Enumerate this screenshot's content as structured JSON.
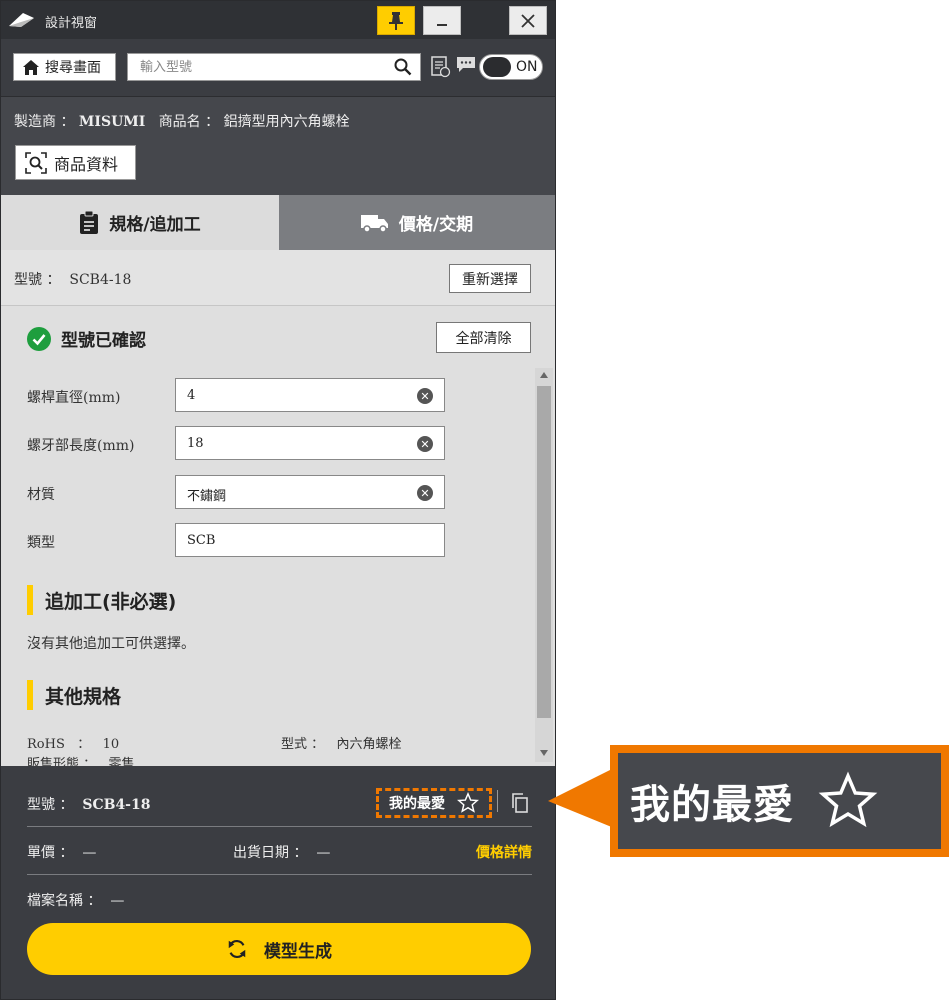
{
  "window": {
    "title": "設計視窗"
  },
  "toolbar": {
    "home_label": "搜尋畫面",
    "search_placeholder": "輸入型號",
    "toggle_label": "ON"
  },
  "product": {
    "maker_label": "製造商",
    "maker_value": "MISUMI",
    "name_label": "商品名",
    "name_value": "鋁擠型用內六角螺栓",
    "info_button": "商品資料"
  },
  "tabs": [
    {
      "label": "規格/追加工",
      "active": true
    },
    {
      "label": "價格/交期",
      "active": false
    }
  ],
  "model": {
    "label": "型號",
    "value": "SCB4-18",
    "reselect_button": "重新選擇",
    "confirmed_text": "型號已確認",
    "clear_all_button": "全部清除"
  },
  "fields": [
    {
      "label": "螺桿直徑(mm)",
      "value": "4",
      "clearable": true
    },
    {
      "label": "螺牙部長度(mm)",
      "value": "18",
      "clearable": true
    },
    {
      "label": "材質",
      "value": "不鏽鋼",
      "clearable": true
    },
    {
      "label": "類型",
      "value": "SCB",
      "clearable": false
    }
  ],
  "sections": {
    "extra_title": "追加工(非必選)",
    "extra_note": "沒有其他追加工可供選擇。",
    "other_title": "其他規格"
  },
  "other_specs": {
    "rohs_label": "RoHS",
    "rohs_value": "10",
    "form_label": "型式",
    "form_value": "內六角螺栓",
    "sales_label": "販售形態",
    "sales_value": "零售"
  },
  "summary": {
    "model_label": "型號",
    "model_value": "SCB4-18",
    "favorite_label": "我的最愛",
    "unit_price_label": "單價",
    "unit_price_value": "—",
    "ship_date_label": "出貨日期",
    "ship_date_value": "—",
    "price_detail_link": "價格詳情",
    "filename_label": "檔案名稱",
    "filename_value": "—",
    "generate_button": "模型生成"
  },
  "callout": {
    "text": "我的最愛"
  },
  "colors": {
    "accent": "#ffcd00",
    "highlight": "#f07800",
    "dark_bg": "#3b3d42"
  }
}
